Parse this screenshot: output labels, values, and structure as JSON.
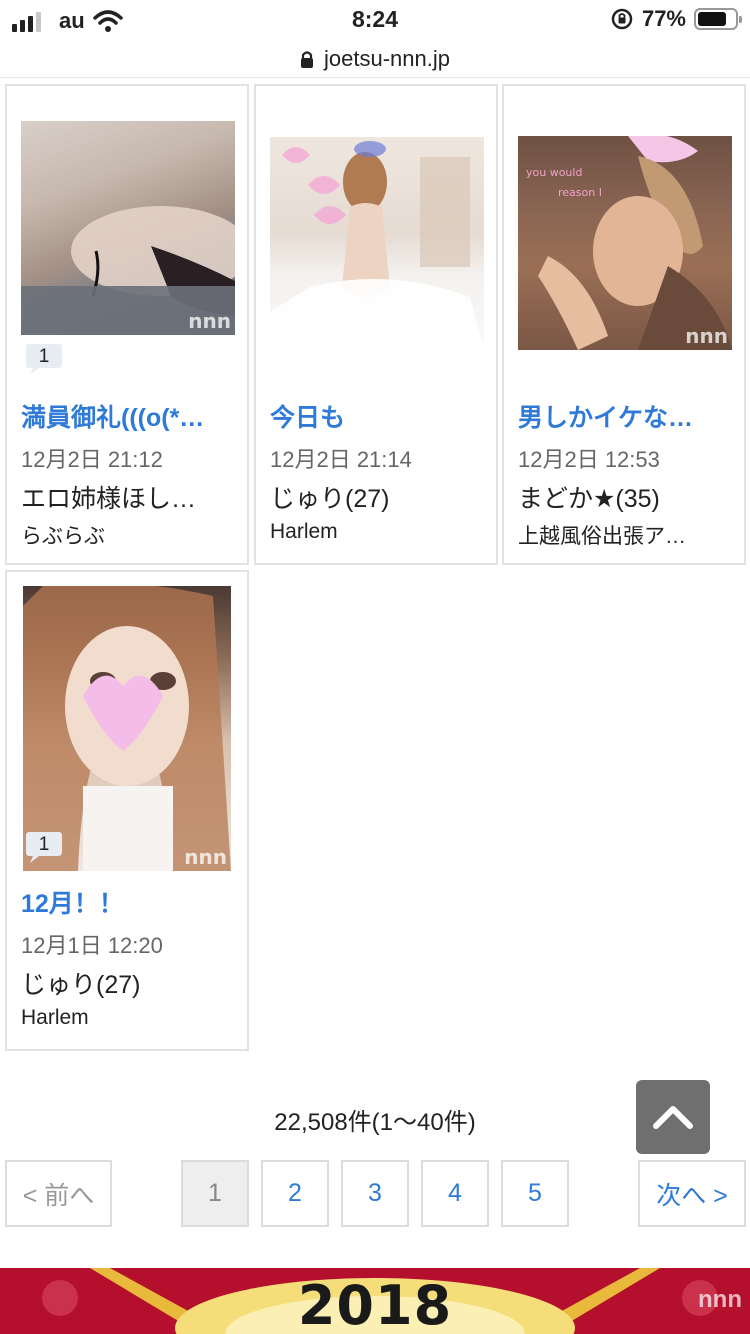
{
  "status_bar": {
    "carrier": "au",
    "time": "8:24",
    "battery": "77%",
    "battery_level": 0.77
  },
  "address_bar": {
    "url": "joetsu-nnn.jp"
  },
  "posts": [
    {
      "title": "満員御礼(((o(*…",
      "date": "12月2日 21:12",
      "author": "エロ姉様ほし…",
      "shop": "らぶらぶ",
      "comments": "1"
    },
    {
      "title": "今日も",
      "date": "12月2日 21:14",
      "author": "じゅり(27)",
      "shop": "Harlem",
      "comments": ""
    },
    {
      "title": "男しかイケな…",
      "date": "12月2日 12:53",
      "author": "まどか★(35)",
      "shop": "上越風俗出張ア…",
      "comments": ""
    },
    {
      "title": "12月！！",
      "date": "12月1日 12:20",
      "author": "じゅり(27)",
      "shop": "Harlem",
      "comments": "1"
    }
  ],
  "pagination": {
    "count_text": "22,508件(1〜40件)",
    "prev": "< 前へ",
    "next": "次へ >",
    "pages": [
      "1",
      "2",
      "3",
      "4",
      "5"
    ],
    "current_page": "1"
  },
  "watermark": "nnn",
  "banner": {
    "year": "2018"
  }
}
